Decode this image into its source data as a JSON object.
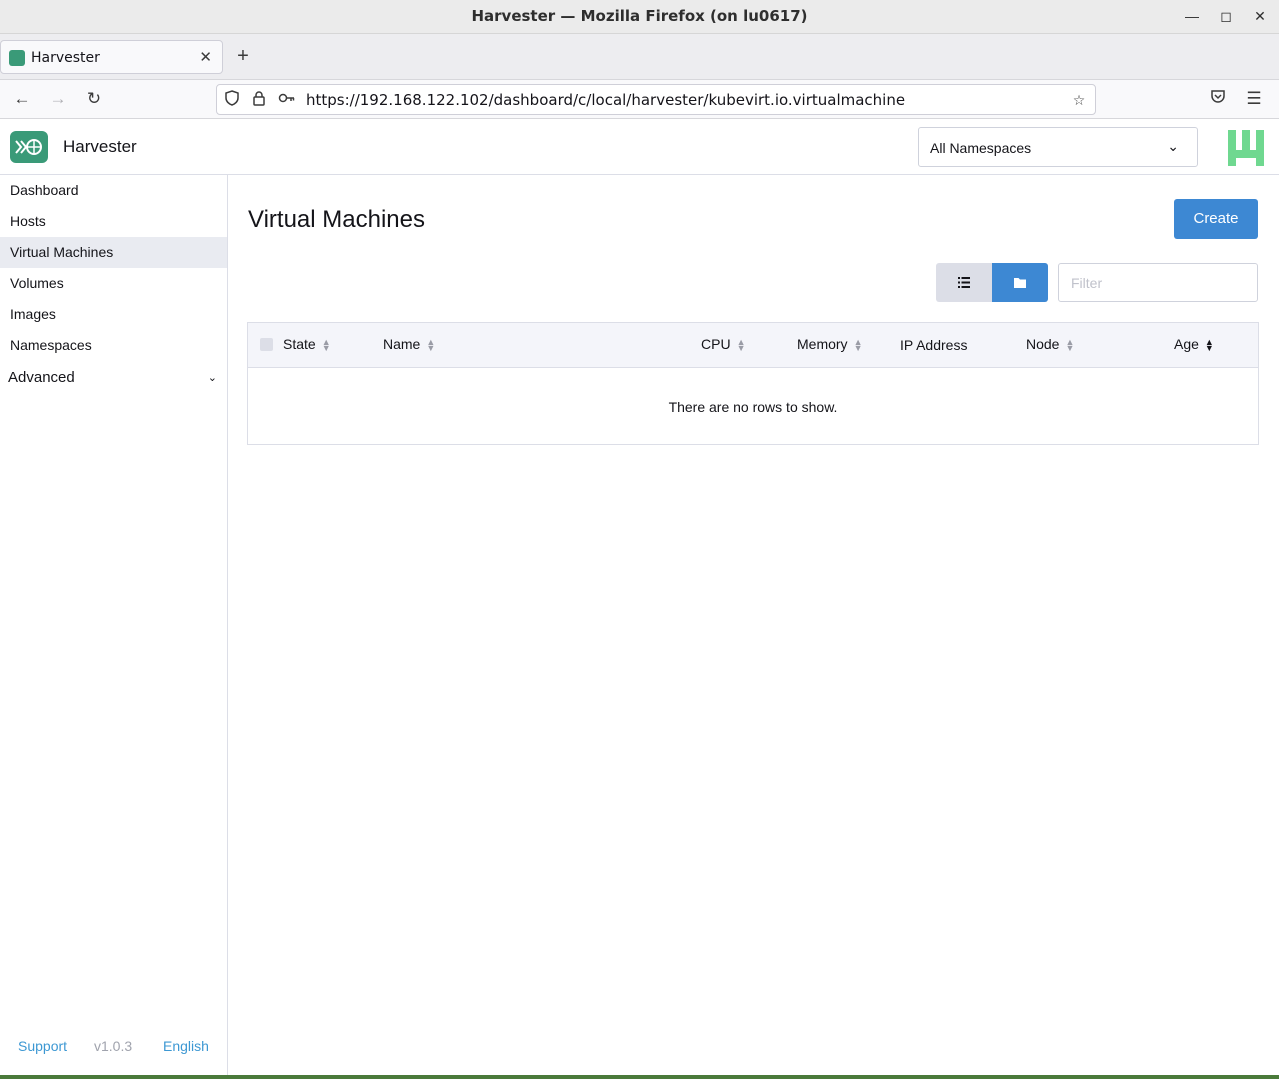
{
  "window": {
    "title": "Harvester — Mozilla Firefox (on lu0617)"
  },
  "browser": {
    "tab_title": "Harvester",
    "url": "https://192.168.122.102/dashboard/c/local/harvester/kubevirt.io.virtualmachine"
  },
  "header": {
    "brand": "Harvester",
    "namespace_selected": "All Namespaces"
  },
  "sidebar": {
    "items": [
      {
        "label": "Dashboard"
      },
      {
        "label": "Hosts"
      },
      {
        "label": "Virtual Machines",
        "active": true
      },
      {
        "label": "Volumes"
      },
      {
        "label": "Images"
      },
      {
        "label": "Namespaces"
      }
    ],
    "group_label": "Advanced",
    "footer": {
      "support": "Support",
      "version": "v1.0.3",
      "language": "English"
    }
  },
  "main": {
    "title": "Virtual Machines",
    "create_label": "Create",
    "filter_placeholder": "Filter",
    "columns": [
      "State",
      "Name",
      "CPU",
      "Memory",
      "IP Address",
      "Node",
      "Age"
    ],
    "empty_message": "There are no rows to show."
  },
  "colors": {
    "accent": "#3d88d3",
    "brand": "#3a9a78",
    "avatar": "#6fd890"
  }
}
